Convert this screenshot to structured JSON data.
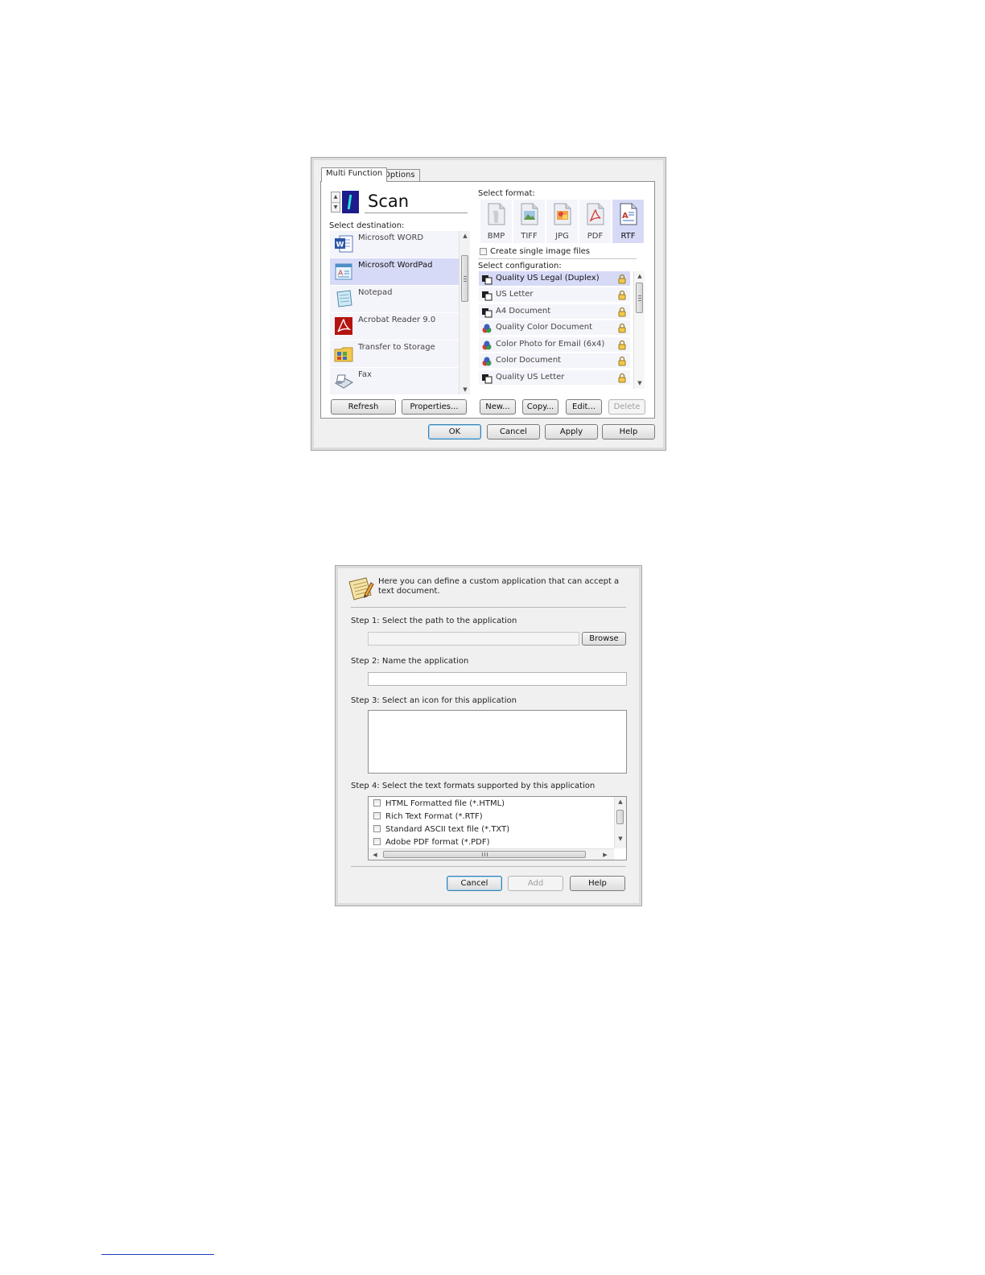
{
  "dialog1": {
    "tabs": [
      "Multi Function",
      "Options"
    ],
    "scan_label": "Scan",
    "select_destination_label": "Select destination:",
    "destinations": [
      {
        "label": "Microsoft WORD",
        "icon": "word-icon"
      },
      {
        "label": "Microsoft WordPad",
        "icon": "wordpad-icon"
      },
      {
        "label": "Notepad",
        "icon": "notepad-icon"
      },
      {
        "label": "Acrobat Reader 9.0",
        "icon": "acrobat-icon"
      },
      {
        "label": "Transfer to Storage",
        "icon": "storage-icon"
      },
      {
        "label": "Fax",
        "icon": "fax-icon"
      }
    ],
    "selected_destination": "Microsoft WordPad",
    "select_format_label": "Select format:",
    "formats": [
      "BMP",
      "TIFF",
      "JPG",
      "PDF",
      "RTF"
    ],
    "selected_format": "RTF",
    "single_image_label": "Create single image files",
    "select_configuration_label": "Select configuration:",
    "configurations": [
      {
        "label": "Quality US Legal (Duplex)",
        "icon": "bw-scan-icon"
      },
      {
        "label": "US Letter",
        "icon": "bw-scan-icon"
      },
      {
        "label": "A4 Document",
        "icon": "bw-scan-icon"
      },
      {
        "label": "Quality Color Document",
        "icon": "color-scan-icon"
      },
      {
        "label": "Color Photo for Email (6x4)",
        "icon": "color-scan-icon"
      },
      {
        "label": "Color Document",
        "icon": "color-scan-icon"
      },
      {
        "label": "Quality US Letter",
        "icon": "bw-scan-icon"
      }
    ],
    "buttons": {
      "refresh": "Refresh",
      "properties": "Properties...",
      "new": "New...",
      "copy": "Copy...",
      "edit": "Edit...",
      "delete": "Delete",
      "ok": "OK",
      "cancel": "Cancel",
      "apply": "Apply",
      "help": "Help"
    }
  },
  "dialog2": {
    "intro": "Here you can define a custom application that can accept a text document.",
    "step1": "Step 1: Select the path to the application",
    "browse": "Browse",
    "step2": "Step 2: Name the application",
    "step3": "Step 3: Select an icon for this application",
    "step4": "Step 4: Select the text formats supported by this application",
    "text_formats": [
      "HTML Formatted file (*.HTML)",
      "Rich Text Format (*.RTF)",
      "Standard ASCII text file (*.TXT)",
      "Adobe PDF format (*.PDF)"
    ],
    "buttons": {
      "cancel": "Cancel",
      "add": "Add",
      "help": "Help"
    }
  },
  "colors": {
    "selection": "#d7daf6",
    "row_bg": "#f4f4fb",
    "default_button_border": "#3c7fb1",
    "footer_link_line": "#1f3fbf"
  }
}
